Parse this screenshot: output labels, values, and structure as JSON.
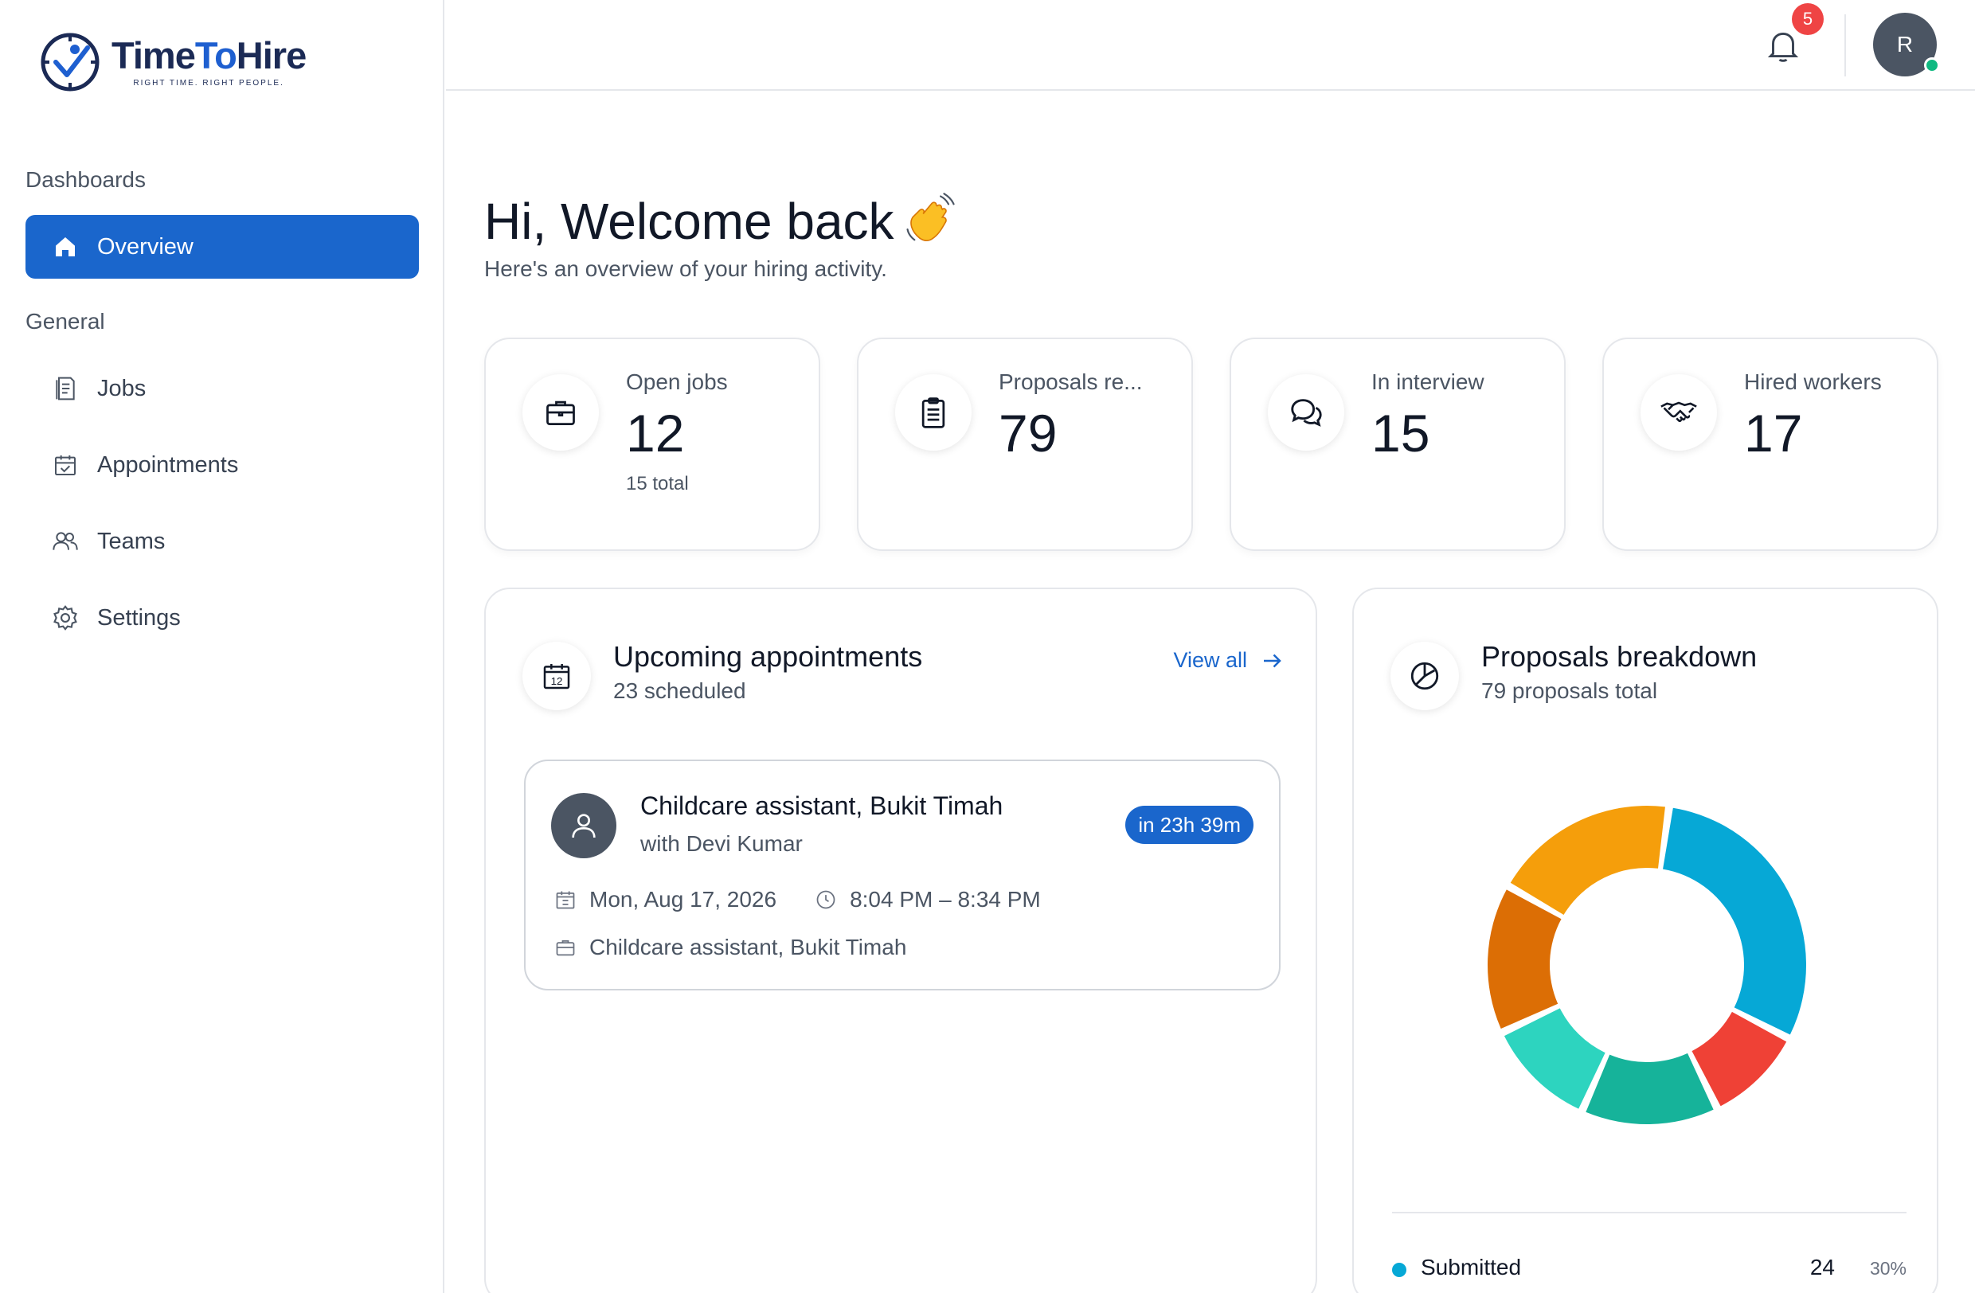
{
  "brand": {
    "name_part1": "Time",
    "name_part2": "To",
    "name_part3": "Hire",
    "tagline": "RIGHT TIME. RIGHT PEOPLE."
  },
  "sidebar": {
    "section_dashboards": "Dashboards",
    "section_general": "General",
    "items": [
      {
        "label": "Overview",
        "icon": "home-icon",
        "active": true
      },
      {
        "label": "Jobs",
        "icon": "document-icon"
      },
      {
        "label": "Appointments",
        "icon": "calendar-check-icon"
      },
      {
        "label": "Teams",
        "icon": "users-icon"
      },
      {
        "label": "Settings",
        "icon": "gear-icon"
      }
    ]
  },
  "topbar": {
    "notification_count": "5",
    "avatar_initial": "R",
    "online": true
  },
  "welcome": {
    "title": "Hi, Welcome back",
    "subtitle": "Here's an overview of your hiring activity."
  },
  "stats": [
    {
      "label": "Open jobs",
      "value": "12",
      "sub": "15 total",
      "icon": "briefcase-icon"
    },
    {
      "label": "Proposals re...",
      "value": "79",
      "sub": "",
      "icon": "clipboard-icon"
    },
    {
      "label": "In interview",
      "value": "15",
      "sub": "",
      "icon": "chat-bubbles-icon"
    },
    {
      "label": "Hired workers",
      "value": "17",
      "sub": "",
      "icon": "handshake-icon"
    }
  ],
  "appointments": {
    "title": "Upcoming appointments",
    "subtitle": "23 scheduled",
    "view_all": "View all",
    "calendar_day": "12",
    "items": [
      {
        "title": "Childcare assistant, Bukit Timah",
        "with": "with Devi Kumar",
        "countdown": "in 23h 39m",
        "date": "Mon, Aug 17, 2026",
        "time": "8:04 PM – 8:34 PM",
        "job": "Childcare assistant, Bukit Timah"
      }
    ]
  },
  "breakdown": {
    "title": "Proposals breakdown",
    "subtitle": "79 proposals total",
    "legend": [
      {
        "name": "Submitted",
        "count": "24",
        "pct": "30%",
        "color": "#06a8d6"
      }
    ]
  },
  "chart_data": {
    "type": "pie",
    "donut": true,
    "total": 79,
    "segments": [
      {
        "value": 24,
        "color": "#06a8d6"
      },
      {
        "value": 8,
        "color": "#ef4136"
      },
      {
        "value": 11,
        "color": "#16b39a"
      },
      {
        "value": 9,
        "color": "#2dd4bf"
      },
      {
        "value": 12,
        "color": "#dc6e05"
      },
      {
        "value": 15,
        "color": "#f59e0b"
      }
    ],
    "colors": {
      "brand_blue": "#1a66cc",
      "badge_red": "#ef4444",
      "online_green": "#10b981"
    }
  }
}
